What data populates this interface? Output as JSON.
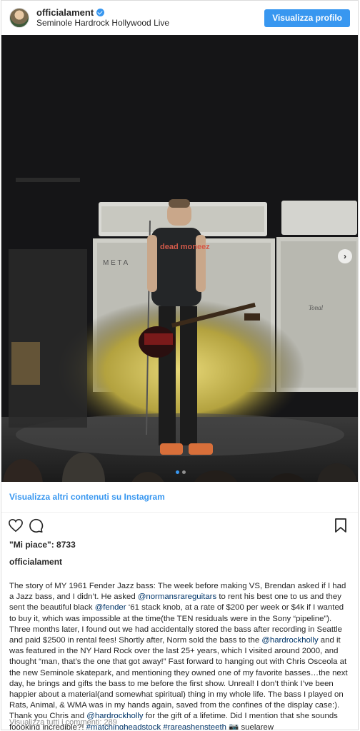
{
  "header": {
    "username": "officialament",
    "location": "Seminole Hardrock Hollywood Live",
    "profile_button": "Visualizza profilo"
  },
  "photo": {
    "stage_text_left": "M E T A",
    "stage_text_right": "Tonal",
    "shirt_text": "dead moneez",
    "carousel_index": 1,
    "carousel_count": 2
  },
  "more_link": "Visualizza altri contenuti su Instagram",
  "likes_text": "\"Mi piace\": 8733",
  "owner": "officialament",
  "caption": {
    "p1": "The story of MY 1961 Fender Jazz bass: The week before making VS, Brendan asked if I had a Jazz bass, and I didn’t. He asked ",
    "m1": "@normansrareguitars",
    "p2": " to rent his best one to us and they sent the beautiful black ",
    "m2": "@fender",
    "p3": " ‘61 stack knob, at a rate of $200 per week or $4k if I wanted to buy it, which was impossible at the time(the TEN residuals were in the Sony “pipeline”). Three months later, I found out we had accidentally stored the bass after recording in Seattle and paid $2500 in rental fees! Shortly after, Norm sold the bass to the ",
    "m3": "@hardrockholly",
    "p4": " and it was featured in the NY Hard Rock over the last 25+ years, which I visited around 2000, and thought “man, that’s the one that got away!” Fast forward to hanging out with Chris Osceola at the new Seminole skatepark, and mentioning they owned one of my favorite basses…the next day, he brings and gifts the bass to me before the first show. Unreal! I don’t think I’ve been happier about a material(and somewhat spiritual) thing in my whole life. The bass I played on Rats, Animal, & WMA was in my hands again, saved from the confines of the display case:). Thank you Chris and ",
    "m4": "@hardrockholly",
    "p5": " for the gift of a lifetime. Did I mention that she sounds foooking incredible?! ",
    "m5": "#matchingheadstock",
    "p6": " ",
    "m6": "#rareashensteeth",
    "p7": " 📷 suelarew"
  },
  "comments_text": "Visualizza tutti i commenti: 289",
  "colors": {
    "accent": "#3897f0",
    "link_dark": "#003569",
    "text": "#262626",
    "muted": "#8e8e8e"
  }
}
